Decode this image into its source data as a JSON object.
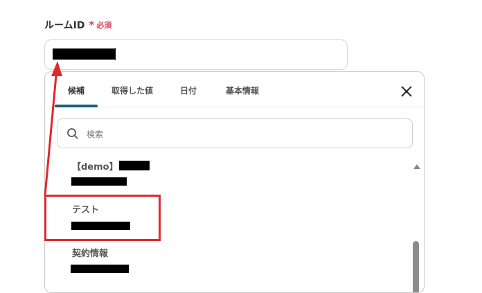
{
  "field": {
    "label": "ルームID",
    "required_mark": "*",
    "required_text": "必須",
    "value_redacted": true
  },
  "panel": {
    "tabs": [
      {
        "label": "候補",
        "active": true
      },
      {
        "label": "取得した値",
        "active": false
      },
      {
        "label": "日付",
        "active": false
      },
      {
        "label": "基本情報",
        "active": false
      }
    ],
    "search": {
      "placeholder": "検索",
      "value": ""
    },
    "items": [
      {
        "title": "【demo】",
        "sub_redacted": true
      },
      {
        "title": "テスト",
        "sub_redacted": true
      },
      {
        "title": "契約情報",
        "sub_redacted": true
      }
    ]
  },
  "colors": {
    "accent": "#16607d",
    "required": "#e2445c",
    "annotation": "#e0282c"
  },
  "icons": [
    "close-icon",
    "search-icon",
    "scroll-up-icon"
  ]
}
